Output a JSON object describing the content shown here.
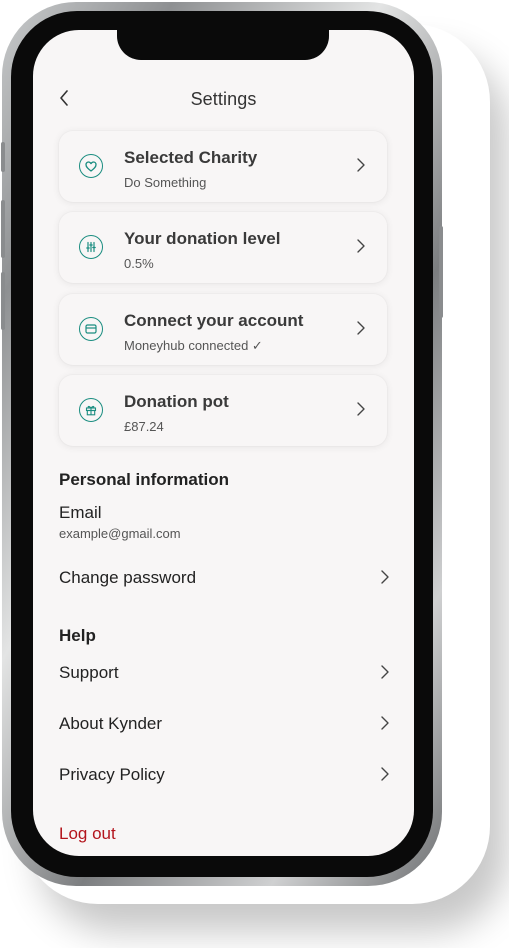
{
  "header": {
    "title": "Settings",
    "back_icon": "chevron-left-icon"
  },
  "cards": [
    {
      "title": "Selected Charity",
      "subtitle": "Do Something",
      "icon": "heart-icon"
    },
    {
      "title": "Your donation level",
      "subtitle": "0.5%",
      "icon": "sliders-icon"
    },
    {
      "title": "Connect your account",
      "subtitle": "Moneyhub connected ✓",
      "icon": "wallet-icon"
    },
    {
      "title": "Donation pot",
      "subtitle": "£87.24",
      "icon": "gift-icon"
    }
  ],
  "personal": {
    "heading": "Personal information",
    "email_label": "Email",
    "email_value": "example@gmail.com",
    "change_password": "Change password"
  },
  "help": {
    "heading": "Help",
    "items": [
      "Support",
      "About Kynder",
      "Privacy Policy"
    ]
  },
  "logout_label": "Log out",
  "colors": {
    "accent": "#1a8d80",
    "danger": "#b3141c",
    "screen_bg": "#f8f6f6"
  }
}
